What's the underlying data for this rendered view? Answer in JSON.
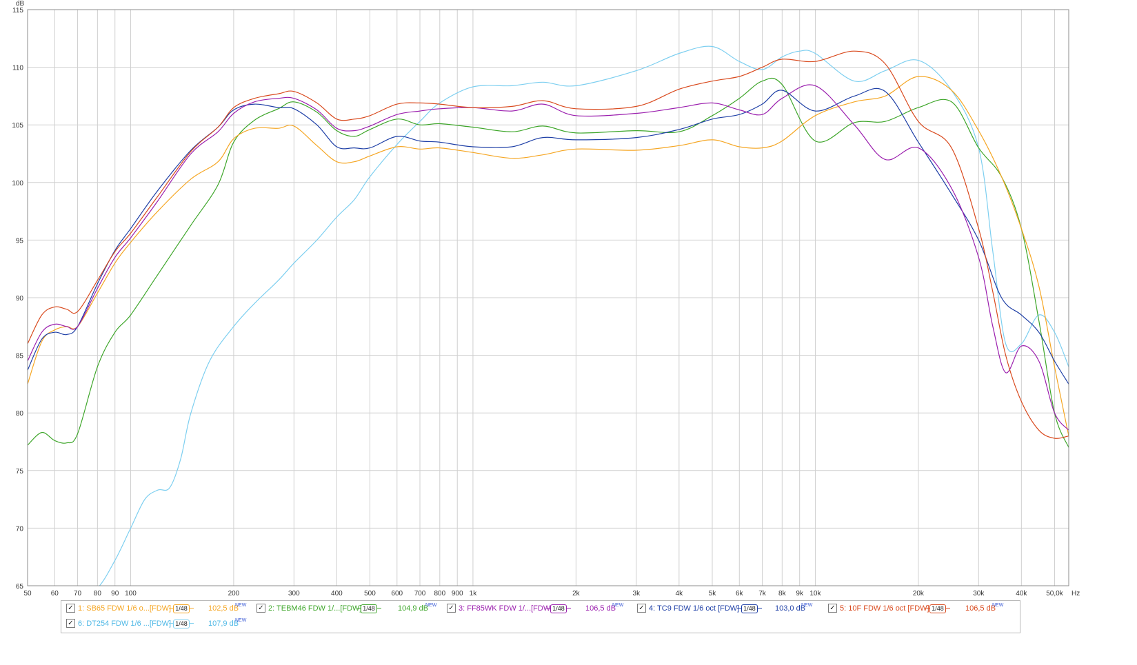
{
  "chart_data": {
    "type": "line",
    "x_scale": "log",
    "xlim": [
      50,
      55000
    ],
    "ylim": [
      65,
      115
    ],
    "x_unit_label": "Hz",
    "y_unit_label": "dB",
    "x_ticks": [
      {
        "v": 50,
        "label": "50"
      },
      {
        "v": 60,
        "label": "60"
      },
      {
        "v": 70,
        "label": "70"
      },
      {
        "v": 80,
        "label": "80"
      },
      {
        "v": 90,
        "label": "90"
      },
      {
        "v": 100,
        "label": "100"
      },
      {
        "v": 200,
        "label": "200"
      },
      {
        "v": 300,
        "label": "300"
      },
      {
        "v": 400,
        "label": "400"
      },
      {
        "v": 500,
        "label": "500"
      },
      {
        "v": 600,
        "label": "600"
      },
      {
        "v": 700,
        "label": "700"
      },
      {
        "v": 800,
        "label": "800"
      },
      {
        "v": 900,
        "label": "900"
      },
      {
        "v": 1000,
        "label": "1k"
      },
      {
        "v": 2000,
        "label": "2k"
      },
      {
        "v": 3000,
        "label": "3k"
      },
      {
        "v": 4000,
        "label": "4k"
      },
      {
        "v": 5000,
        "label": "5k"
      },
      {
        "v": 6000,
        "label": "6k"
      },
      {
        "v": 7000,
        "label": "7k"
      },
      {
        "v": 8000,
        "label": "8k"
      },
      {
        "v": 9000,
        "label": "9k"
      },
      {
        "v": 10000,
        "label": "10k"
      },
      {
        "v": 20000,
        "label": "20k"
      },
      {
        "v": 30000,
        "label": "30k"
      },
      {
        "v": 40000,
        "label": "40k"
      },
      {
        "v": 50000,
        "label": "50,0k"
      }
    ],
    "y_ticks": [
      115,
      110,
      105,
      100,
      95,
      90,
      85,
      80,
      75,
      70,
      65
    ],
    "grid": true,
    "legend_position": "bottom",
    "series": [
      {
        "name": "1: SB65 FDW 1/6 o...[FDW]",
        "color": "#f5a623",
        "level": "102,5 dB",
        "x": [
          50,
          55,
          60,
          65,
          70,
          80,
          90,
          100,
          120,
          150,
          180,
          200,
          230,
          270,
          300,
          350,
          400,
          450,
          500,
          600,
          700,
          800,
          1000,
          1300,
          1600,
          2000,
          3000,
          4000,
          5000,
          6000,
          7000,
          8000,
          10000,
          13000,
          16000,
          20000,
          25000,
          30000,
          35000,
          40000,
          45000,
          50000,
          55000
        ],
        "y": [
          82.5,
          86.2,
          87.2,
          87.5,
          87.5,
          90.4,
          93,
          94.8,
          97.5,
          100.3,
          101.8,
          103.8,
          104.7,
          104.7,
          104.9,
          103.2,
          101.8,
          101.8,
          102.3,
          103.1,
          102.9,
          103,
          102.6,
          102.1,
          102.4,
          102.9,
          102.8,
          103.2,
          103.7,
          103.1,
          103,
          103.6,
          105.8,
          107,
          107.5,
          109.2,
          108,
          104.5,
          100.5,
          96,
          91,
          84,
          78
        ]
      },
      {
        "name": "2: TEBM46 FDW 1/...[FDW]",
        "color": "#3ea62a",
        "level": "104,9 dB",
        "x": [
          50,
          55,
          60,
          65,
          70,
          80,
          90,
          100,
          120,
          150,
          180,
          200,
          230,
          270,
          300,
          350,
          400,
          450,
          500,
          600,
          700,
          800,
          1000,
          1300,
          1600,
          2000,
          3000,
          4000,
          5000,
          6000,
          7000,
          8000,
          10000,
          13000,
          16000,
          20000,
          25000,
          30000,
          35000,
          40000,
          45000,
          50000,
          55000
        ],
        "y": [
          77.2,
          78.3,
          77.6,
          77.4,
          78.2,
          84,
          87,
          88.5,
          92,
          96.3,
          99.8,
          103.5,
          105.4,
          106.4,
          107,
          106.1,
          104.5,
          104,
          104.6,
          105.5,
          105,
          105.1,
          104.8,
          104.4,
          104.9,
          104.3,
          104.5,
          104.4,
          105.8,
          107.3,
          108.8,
          108.5,
          103.6,
          105.2,
          105.3,
          106.5,
          107,
          103,
          100.5,
          96,
          88,
          80,
          77
        ]
      },
      {
        "name": "3: FF85WK FDW 1/...[FDW]",
        "color": "#9b1fae",
        "level": "106,5 dB",
        "x": [
          50,
          55,
          60,
          65,
          70,
          80,
          90,
          100,
          120,
          150,
          180,
          200,
          230,
          270,
          300,
          350,
          400,
          450,
          500,
          600,
          700,
          800,
          1000,
          1300,
          1600,
          2000,
          3000,
          4000,
          5000,
          6000,
          7000,
          8000,
          10000,
          13000,
          16000,
          20000,
          25000,
          30000,
          33000,
          36000,
          40000,
          45000,
          50000,
          55000
        ],
        "y": [
          84.5,
          87,
          87.7,
          87.5,
          87.5,
          90.8,
          93.5,
          95.2,
          98.4,
          102.5,
          104.4,
          106,
          107,
          107.3,
          107.3,
          106.3,
          104.7,
          104.5,
          104.9,
          105.9,
          106.2,
          106.4,
          106.5,
          106.2,
          106.8,
          105.8,
          106,
          106.5,
          106.9,
          106.3,
          105.9,
          107.3,
          108.4,
          105,
          102,
          103,
          99.5,
          93.5,
          87.5,
          83.5,
          85.8,
          84.5,
          80,
          78.5
        ]
      },
      {
        "name": "4: TC9 FDW 1/6 oct [FDW]",
        "color": "#1e3fa6",
        "level": "103,0 dB",
        "x": [
          50,
          55,
          60,
          65,
          70,
          80,
          90,
          100,
          120,
          150,
          180,
          200,
          230,
          270,
          300,
          350,
          400,
          450,
          500,
          600,
          700,
          800,
          1000,
          1300,
          1600,
          2000,
          3000,
          4000,
          5000,
          6000,
          7000,
          8000,
          10000,
          13000,
          16000,
          20000,
          25000,
          30000,
          35000,
          40000,
          45000,
          50000,
          55000
        ],
        "y": [
          83.7,
          86.4,
          87,
          86.8,
          87.5,
          91.2,
          94.1,
          96,
          99.3,
          102.8,
          104.8,
          106.3,
          106.8,
          106.5,
          106.4,
          105,
          103.1,
          103,
          103,
          104,
          103.6,
          103.5,
          103.1,
          103.1,
          103.9,
          103.7,
          103.9,
          104.6,
          105.5,
          105.9,
          106.8,
          108,
          106.2,
          107.5,
          107.9,
          103.5,
          99,
          95,
          90,
          88.5,
          87,
          84.5,
          82.5
        ]
      },
      {
        "name": "5: 10F FDW 1/6 oct [FDW]",
        "color": "#d94a1e",
        "level": "106,5 dB",
        "x": [
          50,
          55,
          60,
          65,
          70,
          80,
          90,
          100,
          120,
          150,
          180,
          200,
          230,
          270,
          300,
          350,
          400,
          450,
          500,
          600,
          700,
          800,
          1000,
          1300,
          1600,
          2000,
          3000,
          4000,
          5000,
          6000,
          7000,
          8000,
          10000,
          13000,
          16000,
          20000,
          25000,
          30000,
          33000,
          36000,
          40000,
          45000,
          50000,
          55000
        ],
        "y": [
          86,
          88.5,
          89.2,
          89,
          88.8,
          91.5,
          94,
          95.6,
          98.8,
          102.7,
          104.8,
          106.5,
          107.3,
          107.7,
          107.9,
          106.9,
          105.5,
          105.5,
          105.8,
          106.8,
          106.9,
          106.8,
          106.5,
          106.6,
          107.1,
          106.4,
          106.6,
          108.1,
          108.8,
          109.2,
          110,
          110.7,
          110.5,
          111.4,
          110.3,
          105.3,
          103,
          96,
          90.5,
          85,
          81,
          78.5,
          77.8,
          78
        ]
      },
      {
        "name": "6: DT254 FDW 1/6 ...[FDW]",
        "color": "#7dcff0",
        "level": "107,9 dB",
        "x": [
          62,
          66,
          70,
          80,
          90,
          100,
          110,
          120,
          130,
          140,
          150,
          170,
          200,
          230,
          270,
          300,
          350,
          400,
          450,
          500,
          600,
          700,
          800,
          1000,
          1300,
          1600,
          2000,
          3000,
          4000,
          5000,
          6000,
          7000,
          8000,
          9000,
          10000,
          13000,
          16000,
          20000,
          25000,
          30000,
          33000,
          36000,
          40000,
          45000,
          50000,
          55000
        ],
        "y": [
          65,
          64.5,
          64,
          64.8,
          67.2,
          70,
          72.5,
          73.3,
          73.5,
          76,
          80,
          84.5,
          87.5,
          89.5,
          91.5,
          93,
          95,
          97,
          98.5,
          100.5,
          103.3,
          105.3,
          106.9,
          108.3,
          108.4,
          108.7,
          108.4,
          109.7,
          111.2,
          111.8,
          110.5,
          109.8,
          110.9,
          111.4,
          111.2,
          108.8,
          109.7,
          110.6,
          108,
          103,
          94,
          86,
          86,
          88.5,
          87,
          84
        ]
      }
    ]
  }
}
